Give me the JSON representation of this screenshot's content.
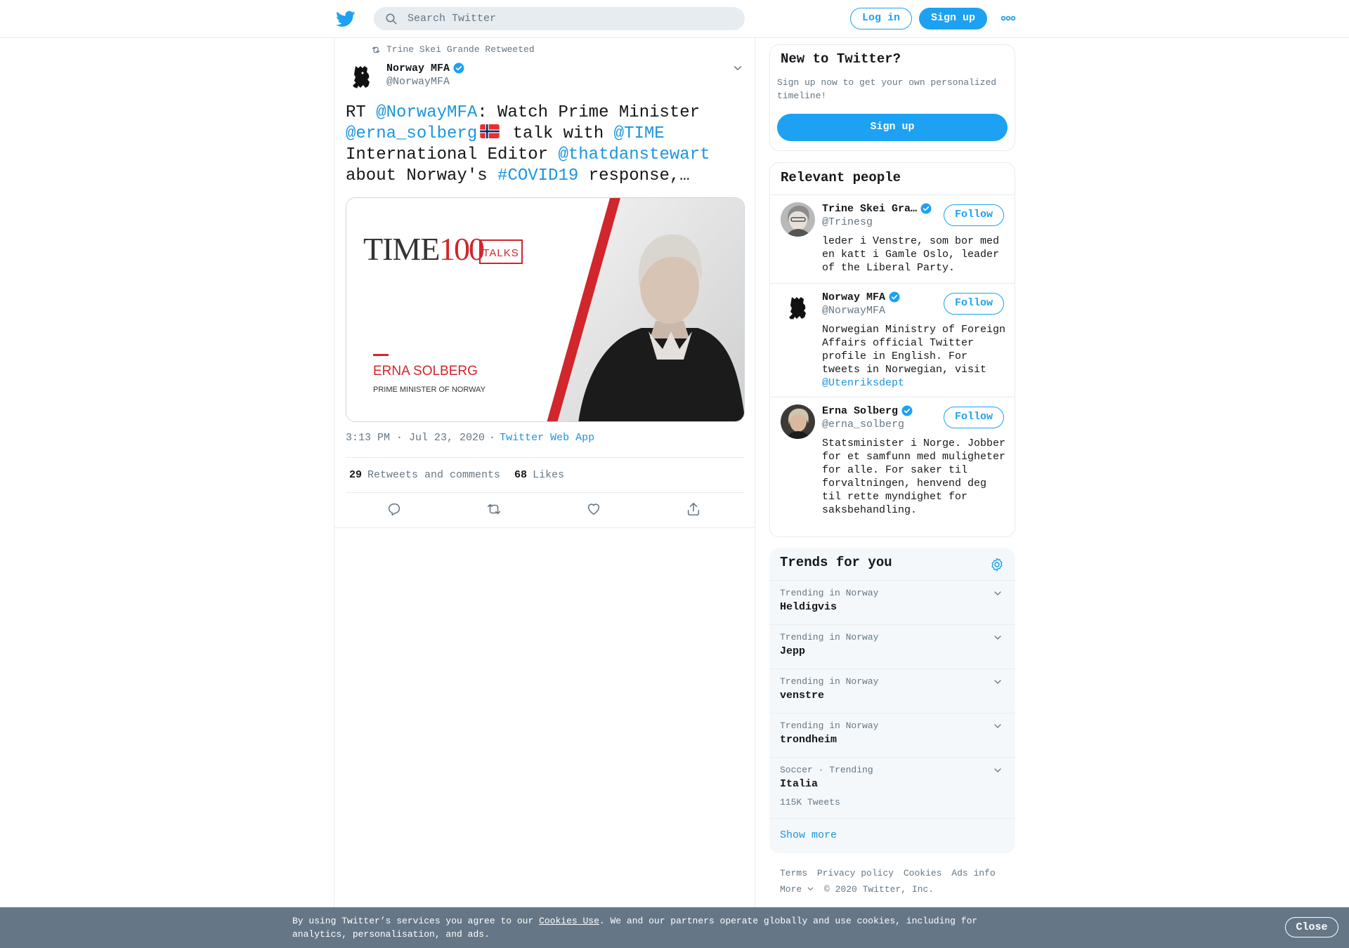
{
  "topbar": {
    "search_placeholder": "Search Twitter",
    "login_label": "Log in",
    "signup_label": "Sign up"
  },
  "tweet": {
    "retweeted_by": "Trine Skei Grande Retweeted",
    "author_name": "Norway MFA",
    "author_handle": "@NorwayMFA",
    "text": {
      "t1": "RT ",
      "l1": "@NorwayMFA",
      "t2": ": Watch Prime Minister ",
      "l2": "@erna_solberg",
      "t3": " talk with ",
      "l3": "@TIME",
      "t4": " International Editor ",
      "l4": "@thatdanstewart",
      "t5": " about Norway's ",
      "l5": "#COVID19",
      "t6": " response,…"
    },
    "media": {
      "time_word": "TIME",
      "time_number": "100",
      "talks_label": "TALKS",
      "person_name": "ERNA SOLBERG",
      "person_title": "PRIME MINISTER OF NORWAY"
    },
    "timestamp": "3:13 PM · Jul 23, 2020",
    "separator": "·",
    "source_app": "Twitter Web App",
    "retweets_count": "29",
    "retweets_label": "Retweets and comments",
    "likes_count": "68",
    "likes_label": "Likes"
  },
  "sidebar": {
    "new_title": "New to Twitter?",
    "new_desc": "Sign up now to get your own personalized timeline!",
    "new_signup_label": "Sign up",
    "people_title": "Relevant people",
    "follow_label": "Follow",
    "people": [
      {
        "name": "Trine Skei Gra…",
        "handle": "@Trinesg",
        "bio": "leder i Venstre, som bor med en katt i Gamle Oslo, leader of the Liberal Party."
      },
      {
        "name": "Norway MFA",
        "handle": "@NorwayMFA",
        "bio": "Norwegian Ministry of Foreign Affairs official Twitter profile in English. For tweets in Norwegian, visit ",
        "bio_link": "@Utenriksdept"
      },
      {
        "name": "Erna Solberg",
        "handle": "@erna_solberg",
        "bio": "Statsminister i Norge. Jobber for et samfunn med muligheter for alle. For saker til forvaltningen, henvend deg til rette myndighet for saksbehandling."
      }
    ],
    "trends_title": "Trends for you",
    "trends": [
      {
        "context": "Trending in Norway",
        "name": "Heldigvis"
      },
      {
        "context": "Trending in Norway",
        "name": "Jepp"
      },
      {
        "context": "Trending in Norway",
        "name": "venstre"
      },
      {
        "context": "Trending in Norway",
        "name": "trondheim"
      },
      {
        "context": "Soccer · Trending",
        "name": "Italia",
        "count": "115K Tweets"
      }
    ],
    "show_more": "Show more"
  },
  "footer": {
    "terms": "Terms",
    "privacy": "Privacy policy",
    "cookies": "Cookies",
    "ads": "Ads info",
    "more": "More",
    "copyright": "© 2020 Twitter, Inc."
  },
  "cookie_bar": {
    "text_before": "By using Twitter’s services you agree to our ",
    "link": "Cookies Use",
    "text_after": ". We and our partners operate globally and use cookies, including for analytics, personalisation, and ads.",
    "close_label": "Close"
  },
  "colors": {
    "brand_blue": "#1da1f2",
    "link_blue": "#1b95e0",
    "muted_gray": "#657786",
    "cookie_bg": "#657786"
  }
}
